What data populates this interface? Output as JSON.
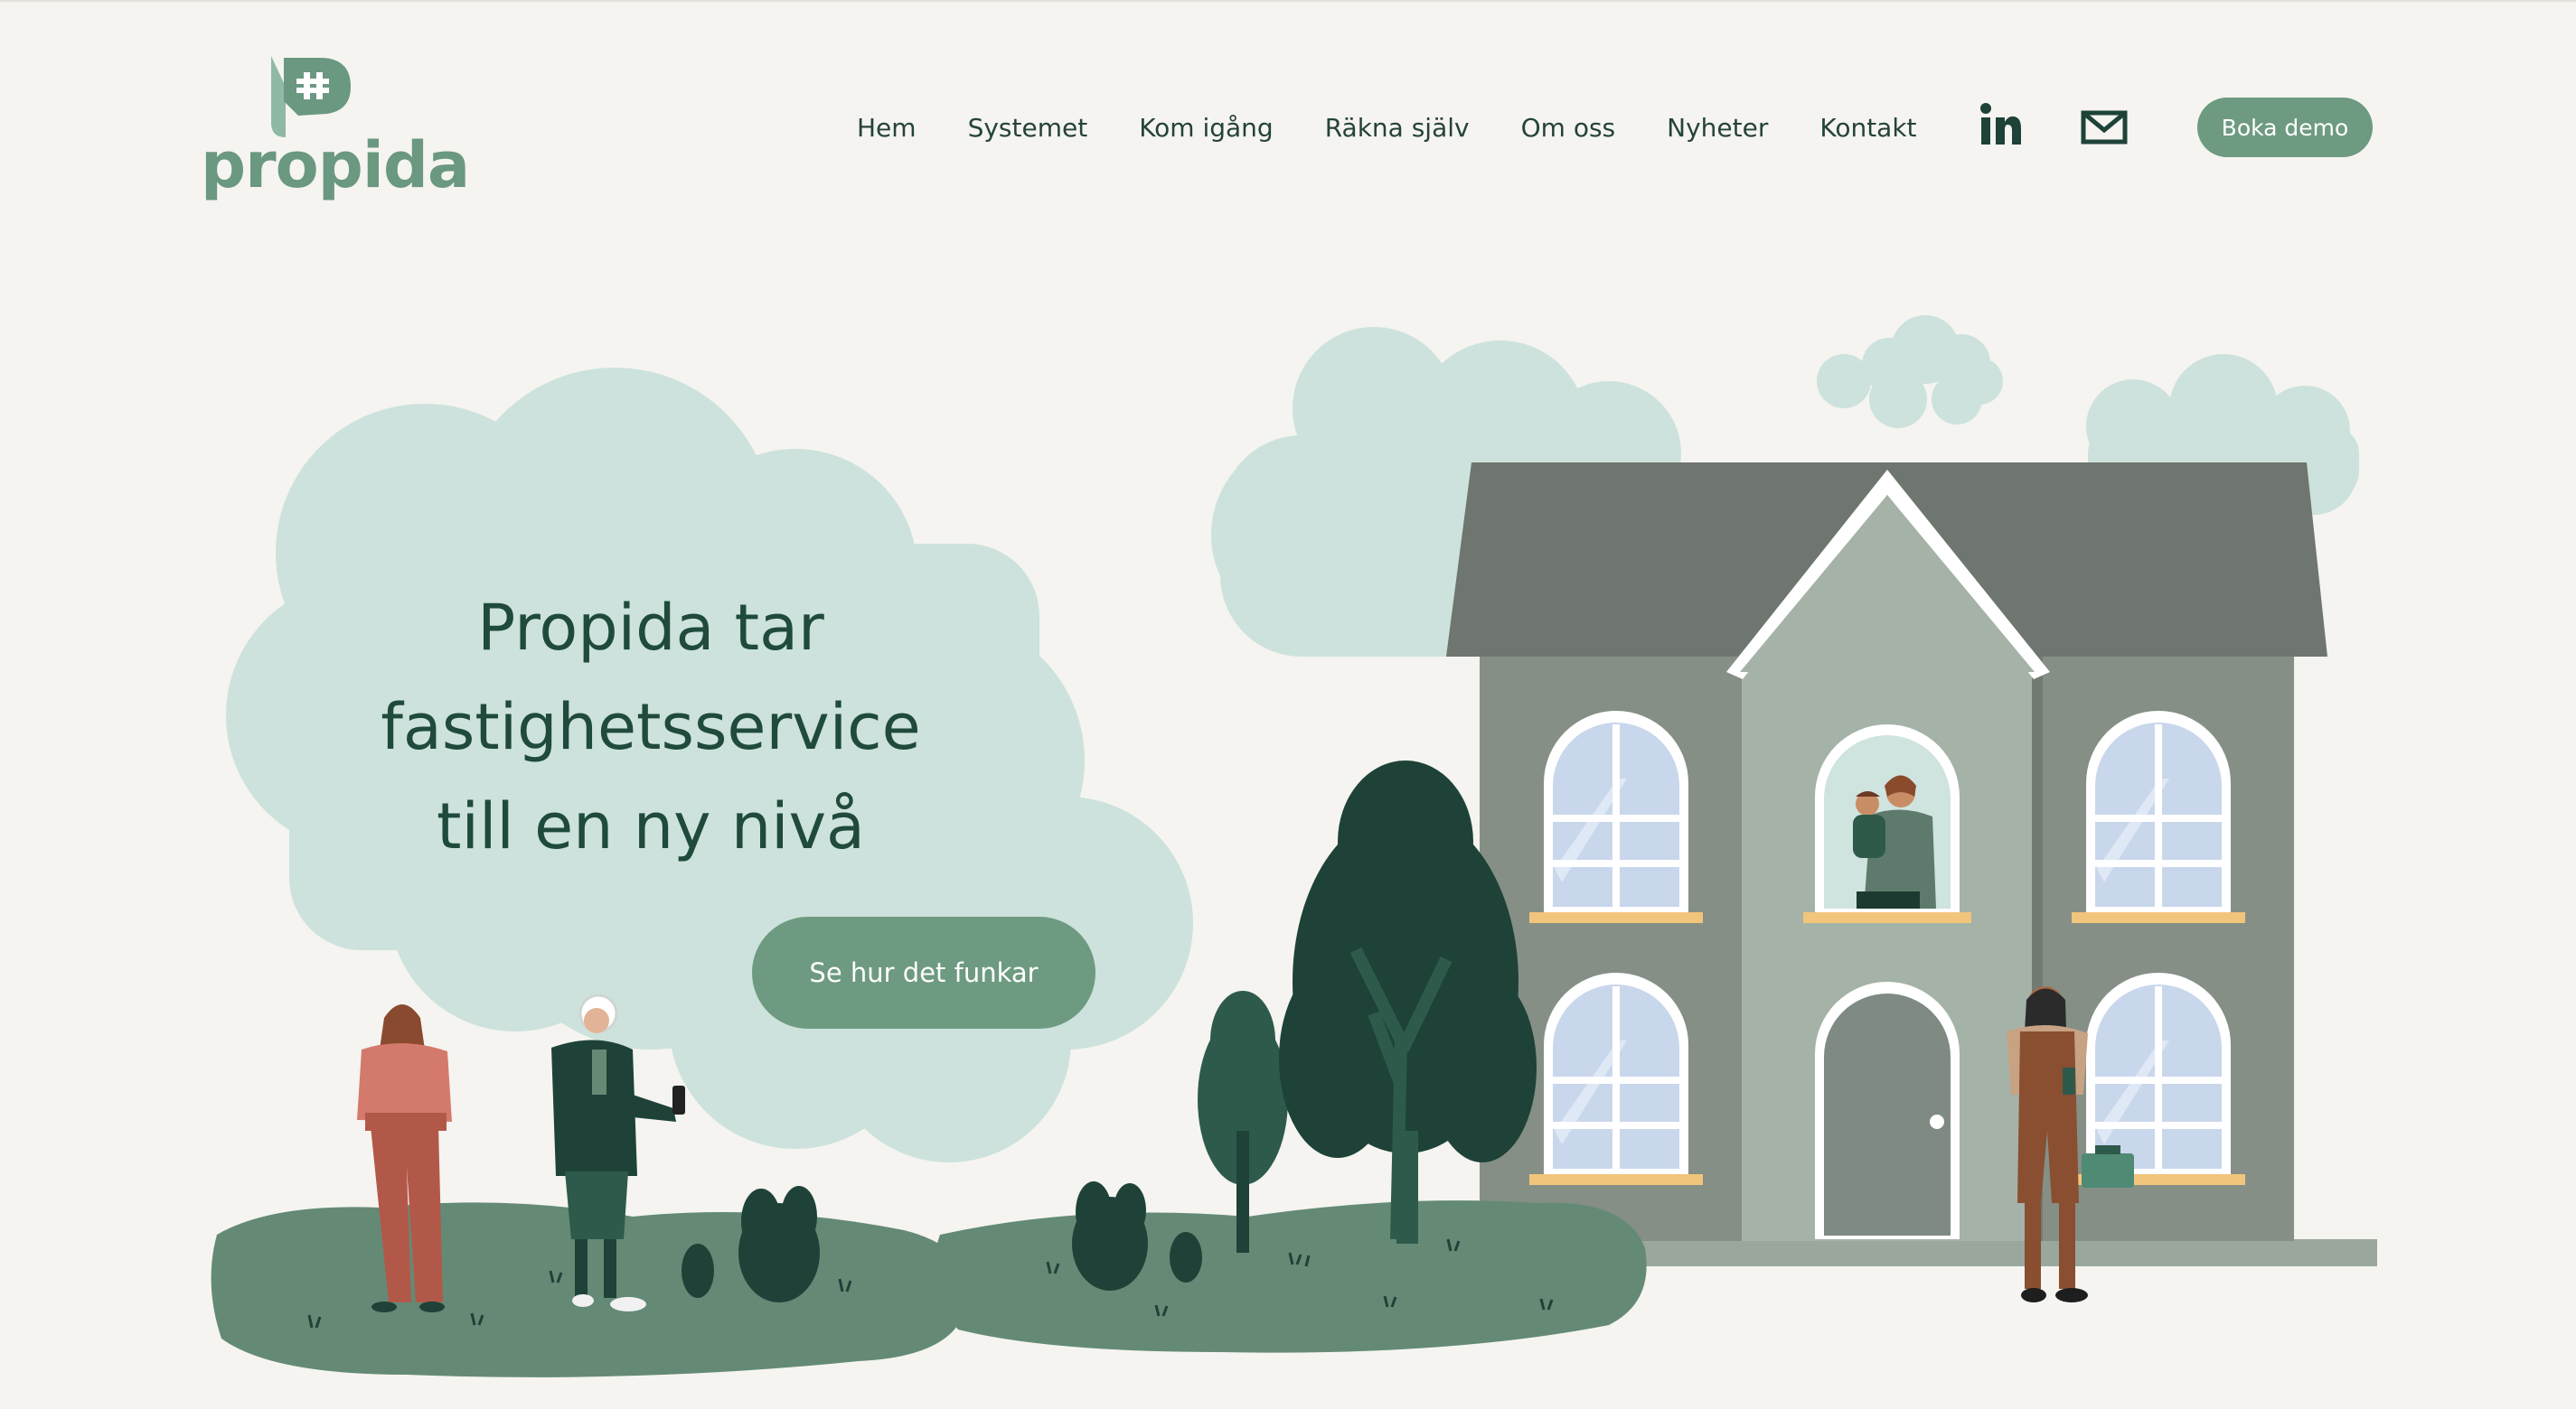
{
  "brand": {
    "name": "propida"
  },
  "nav": {
    "items": [
      {
        "label": "Hem"
      },
      {
        "label": "Systemet"
      },
      {
        "label": "Kom igång"
      },
      {
        "label": "Räkna själv"
      },
      {
        "label": "Om oss"
      },
      {
        "label": "Nyheter"
      },
      {
        "label": "Kontakt"
      }
    ],
    "linkedin_icon": "linkedin-icon",
    "mail_icon": "mail-icon",
    "demo_button": "Boka demo"
  },
  "hero": {
    "title_lines": [
      "Propida tar",
      "fastighetsservice",
      "till en ny nivå"
    ],
    "cta_label": "Se hur det funkar"
  },
  "colors": {
    "background": "#f5f4f0",
    "accent": "#6d9a80",
    "text_dark": "#1f4a3c",
    "cloud": "#cde2dc",
    "grass": "#648a76",
    "tree_dark": "#1e4238",
    "house_roof": "#6f766f",
    "house_wall": "#858f86",
    "house_center": "#a5b2a7",
    "window_glass": "#c9d7ec",
    "window_sill": "#f2c57c"
  }
}
